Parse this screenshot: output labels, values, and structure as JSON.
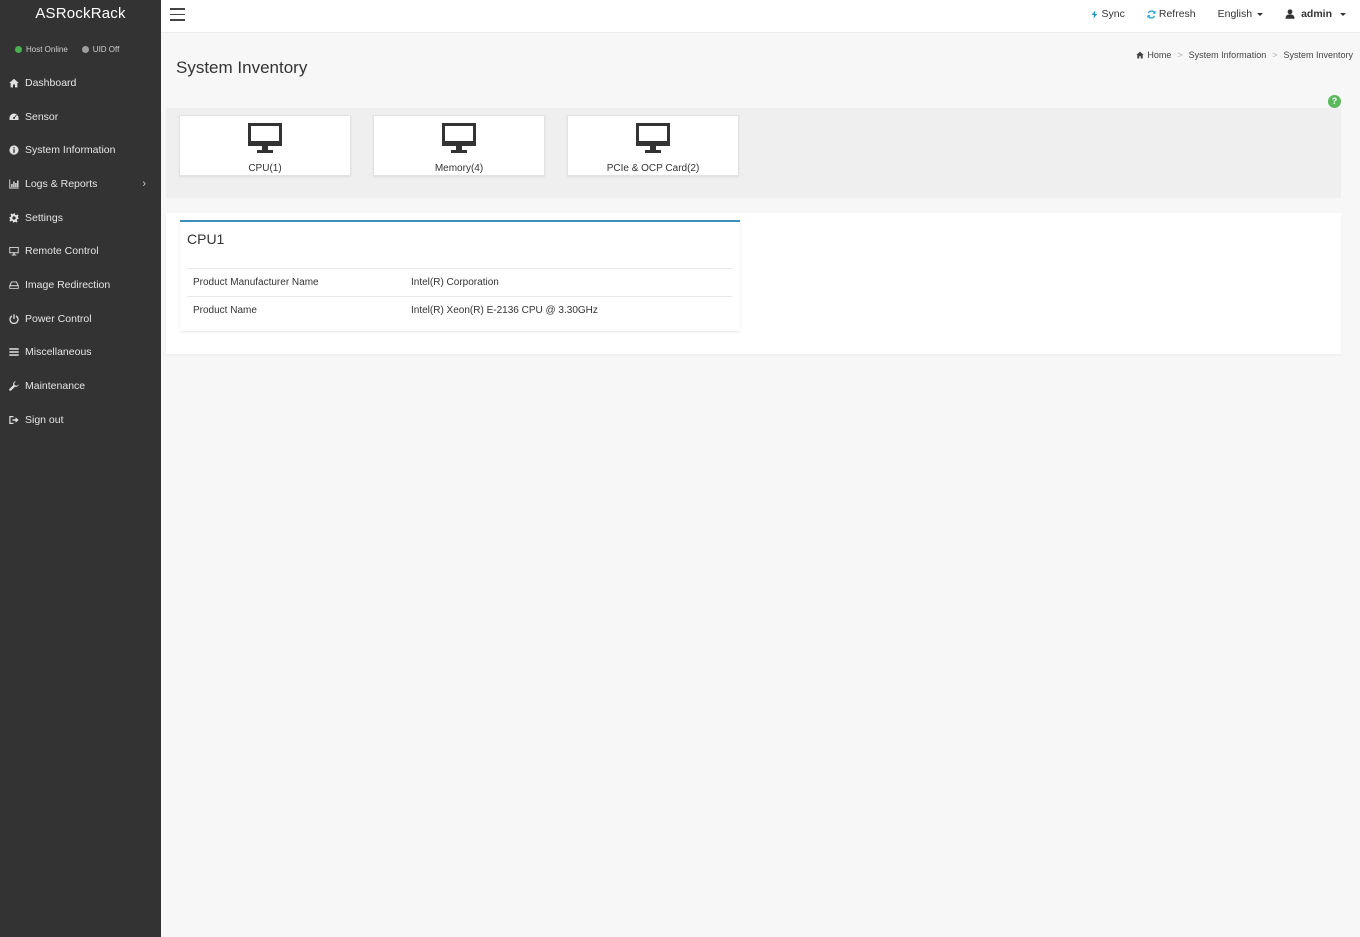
{
  "brand": "ASRockRack",
  "status": {
    "host": {
      "label": "Host Online",
      "color": "#4caf50"
    },
    "uid": {
      "label": "UID Off",
      "color": "#9e9e9e"
    }
  },
  "sidebar": {
    "items": [
      {
        "label": "Dashboard",
        "icon": "home-icon"
      },
      {
        "label": "Sensor",
        "icon": "dashboard-gauge-icon"
      },
      {
        "label": "System Information",
        "icon": "info-circle-icon"
      },
      {
        "label": "Logs & Reports",
        "icon": "bar-chart-icon",
        "has_submenu": true
      },
      {
        "label": "Settings",
        "icon": "gear-icon"
      },
      {
        "label": "Remote Control",
        "icon": "desktop-icon"
      },
      {
        "label": "Image Redirection",
        "icon": "hdd-icon"
      },
      {
        "label": "Power Control",
        "icon": "power-icon"
      },
      {
        "label": "Miscellaneous",
        "icon": "list-icon"
      },
      {
        "label": "Maintenance",
        "icon": "wrench-icon"
      },
      {
        "label": "Sign out",
        "icon": "sign-out-icon"
      }
    ]
  },
  "topbar": {
    "sync": "Sync",
    "refresh": "Refresh",
    "language": "English",
    "user": "admin",
    "accent": "#1a9bd7"
  },
  "page": {
    "title": "System Inventory",
    "breadcrumb": [
      "Home",
      "System Information",
      "System Inventory"
    ]
  },
  "tiles": [
    {
      "label": "CPU(1)",
      "icon": "monitor-icon"
    },
    {
      "label": "Memory(4)",
      "icon": "monitor-icon"
    },
    {
      "label": "PCIe & OCP Card(2)",
      "icon": "monitor-icon"
    }
  ],
  "detail": {
    "title": "CPU1",
    "rows": [
      {
        "key": "Product Manufacturer Name",
        "value": "Intel(R) Corporation"
      },
      {
        "key": "Product Name",
        "value": "Intel(R) Xeon(R) E-2136 CPU @ 3.30GHz"
      }
    ]
  }
}
